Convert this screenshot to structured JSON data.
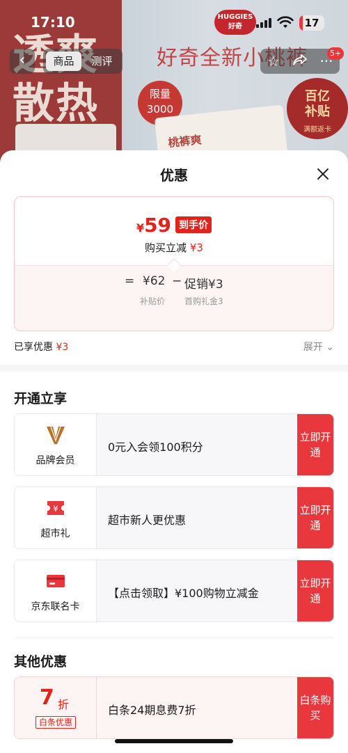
{
  "status_bar": {
    "time": "17:10",
    "battery": "17"
  },
  "nav": {
    "back_icon": "chevron-left-icon",
    "tabs": [
      "商品",
      "测评"
    ],
    "message_count": "5+"
  },
  "background_page": {
    "title": "好奇全新小桃裤",
    "brand": "HUGGIES 好奇",
    "left_banner": [
      "透爽",
      "散热"
    ],
    "badge_limit": [
      "限量",
      "3000"
    ],
    "badge_subsidy": [
      "百亿",
      "补贴",
      "满额返卡"
    ],
    "product_text": "桃裤爽"
  },
  "sheet": {
    "title": "优惠",
    "price_card": {
      "yen": "¥",
      "final_price": "59",
      "price_tag": "到手价",
      "reduce_label": "购买立减",
      "reduce_amount": "¥3",
      "eq": "=",
      "base_price": "¥62",
      "minus": "−",
      "promo": "促销¥3",
      "base_label": "补贴价",
      "promo_label": "首购礼金3"
    },
    "enjoyed_label": "已享优惠",
    "enjoyed_amount": "¥3",
    "expand_label": "展开 ⌄",
    "open_section_title": "开通立享",
    "offers": [
      {
        "name": "品牌会员",
        "desc": "0元入会领100积分",
        "button": "立即开通",
        "icon": "brand-v-icon"
      },
      {
        "name": "超市礼",
        "desc": "超市新人更优惠",
        "button": "立即开通",
        "icon": "coupon-icon"
      },
      {
        "name": "京东联名卡",
        "desc": "【点击领取】¥100购物立减金",
        "button": "立即开通",
        "icon": "card-icon"
      }
    ],
    "other_section_title": "其他优惠",
    "other_offer": {
      "discount_num": "7",
      "discount_unit": "折",
      "discount_tag": "白条优惠",
      "desc": "白条24期息费7折",
      "button": "白条购买"
    }
  },
  "colors": {
    "accent": "#e2231a",
    "button_red": "#e8383d"
  }
}
